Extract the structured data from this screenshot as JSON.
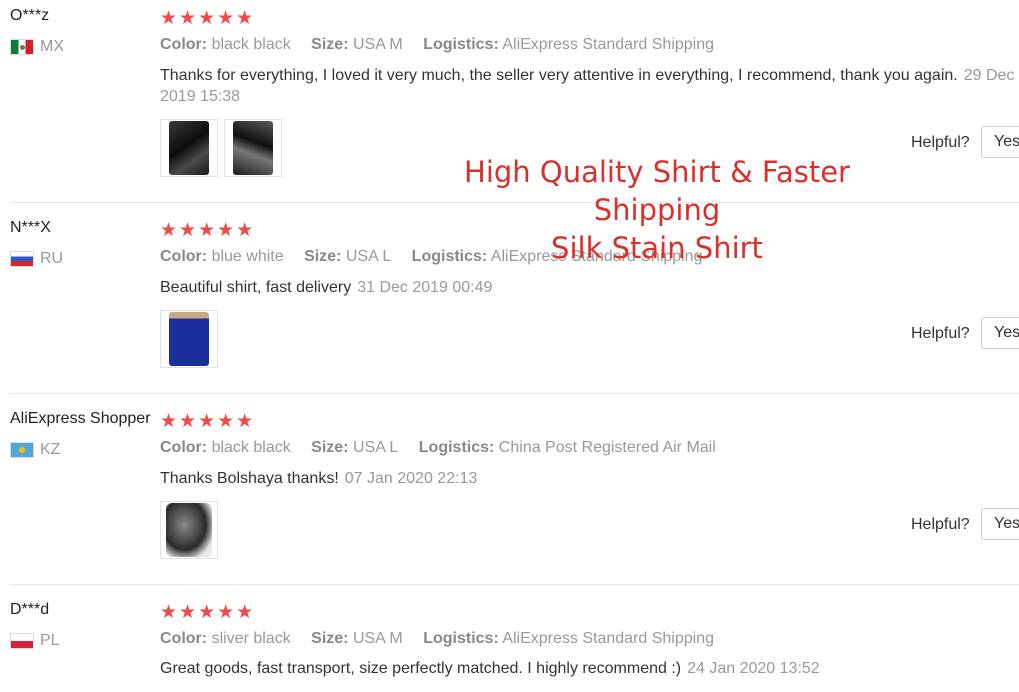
{
  "labels": {
    "color": "Color:",
    "size": "Size:",
    "logistics": "Logistics:",
    "helpful": "Helpful?",
    "yes": "Yes"
  },
  "rating_stars": "★★★★★",
  "reviews": [
    {
      "user": "O***z",
      "country": "MX",
      "flag_icon": "mexico-flag-icon",
      "color": "black black",
      "size": "USA M",
      "logistics": "AliExpress Standard Shipping",
      "text": "Thanks for everything, I loved it very much, the seller very attentive in everything, I recommend, thank you again.",
      "date": "29 Dec 2019 15:38"
    },
    {
      "user": "N***X",
      "country": "RU",
      "flag_icon": "russia-flag-icon",
      "color": "blue white",
      "size": "USA L",
      "logistics": "AliExpress Standard Shipping",
      "text": "Beautiful shirt, fast delivery",
      "date": "31 Dec 2019 00:49"
    },
    {
      "user": "AliExpress Shopper",
      "country": "KZ",
      "flag_icon": "kazakhstan-flag-icon",
      "color": "black black",
      "size": "USA L",
      "logistics": "China Post Registered Air Mail",
      "text": "Thanks Bolshaya thanks!",
      "date": "07 Jan 2020 22:13"
    },
    {
      "user": "D***d",
      "country": "PL",
      "flag_icon": "poland-flag-icon",
      "color": "sliver black",
      "size": "USA M",
      "logistics": "AliExpress Standard Shipping",
      "text": "Great goods, fast transport, size perfectly matched. I highly recommend :)",
      "date": "24 Jan 2020 13:52"
    }
  ],
  "overlay": {
    "line1": "High Quality Shirt & Faster Shipping",
    "line2": "Silk Stain Shirt"
  },
  "colors": {
    "star": "#f04a4a",
    "overlay_text": "#d8302c",
    "muted": "#999999"
  }
}
